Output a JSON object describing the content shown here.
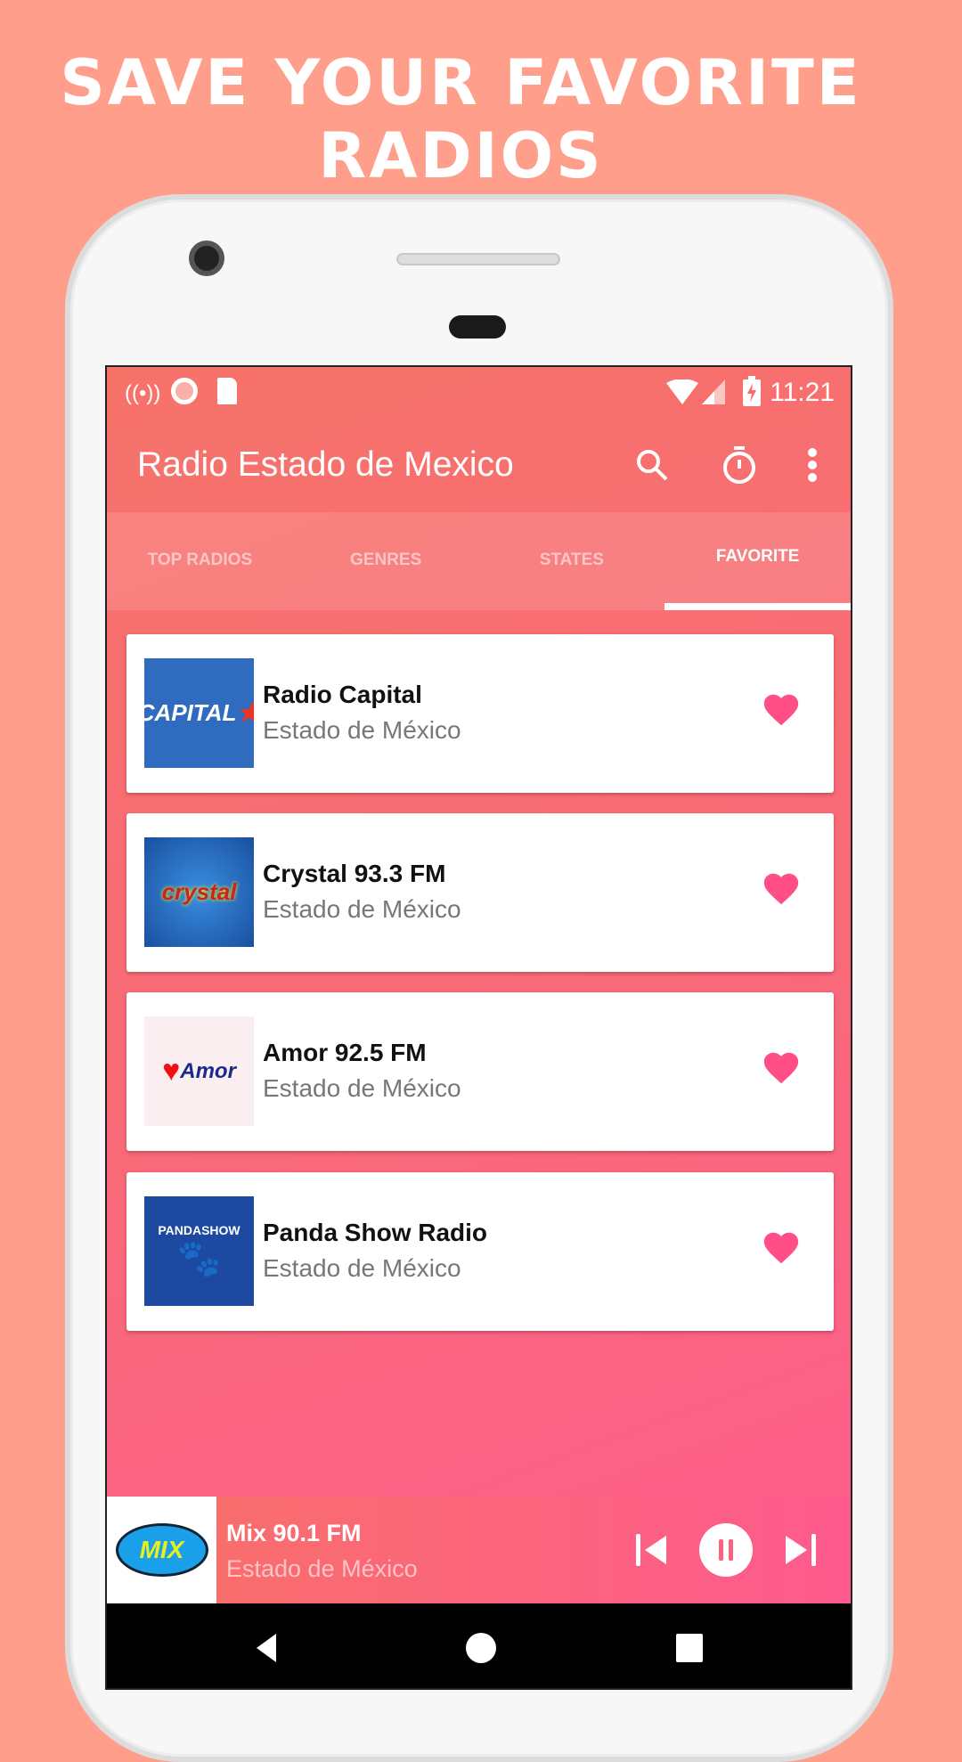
{
  "headline": {
    "line1": "SAVE YOUR FAVORITE",
    "line2": "RADIOS"
  },
  "status_bar": {
    "time": "11:21",
    "icons": [
      "hotspot-icon",
      "record-icon",
      "sd-card-icon",
      "wifi-icon",
      "signal-icon",
      "battery-charging-icon"
    ]
  },
  "app_bar": {
    "title": "Radio Estado de Mexico",
    "actions": [
      "search-icon",
      "timer-icon",
      "more-vert-icon"
    ]
  },
  "tabs": [
    {
      "label": "TOP RADIOS",
      "active": false
    },
    {
      "label": "GENRES",
      "active": false
    },
    {
      "label": "STATES",
      "active": false
    },
    {
      "label": "FAVORITE",
      "active": true
    }
  ],
  "favorites": [
    {
      "name": "Radio Capital",
      "subtitle": "Estado de México",
      "logo_text": "CAPITAL",
      "favorited": true
    },
    {
      "name": "Crystal 93.3 FM",
      "subtitle": "Estado de México",
      "logo_text": "crystal",
      "favorited": true
    },
    {
      "name": "Amor 92.5 FM",
      "subtitle": "Estado de México",
      "logo_text": "Amor",
      "favorited": true
    },
    {
      "name": "Panda Show Radio",
      "subtitle": "Estado de México",
      "logo_text": "PANDASHOW",
      "favorited": true
    }
  ],
  "player": {
    "name": "Mix 90.1 FM",
    "subtitle": "Estado de México",
    "logo_text": "MIX",
    "state": "playing"
  },
  "colors": {
    "background": "#ff9f8b",
    "accent": "#fe5a8e",
    "heart": "#ff4f86"
  }
}
